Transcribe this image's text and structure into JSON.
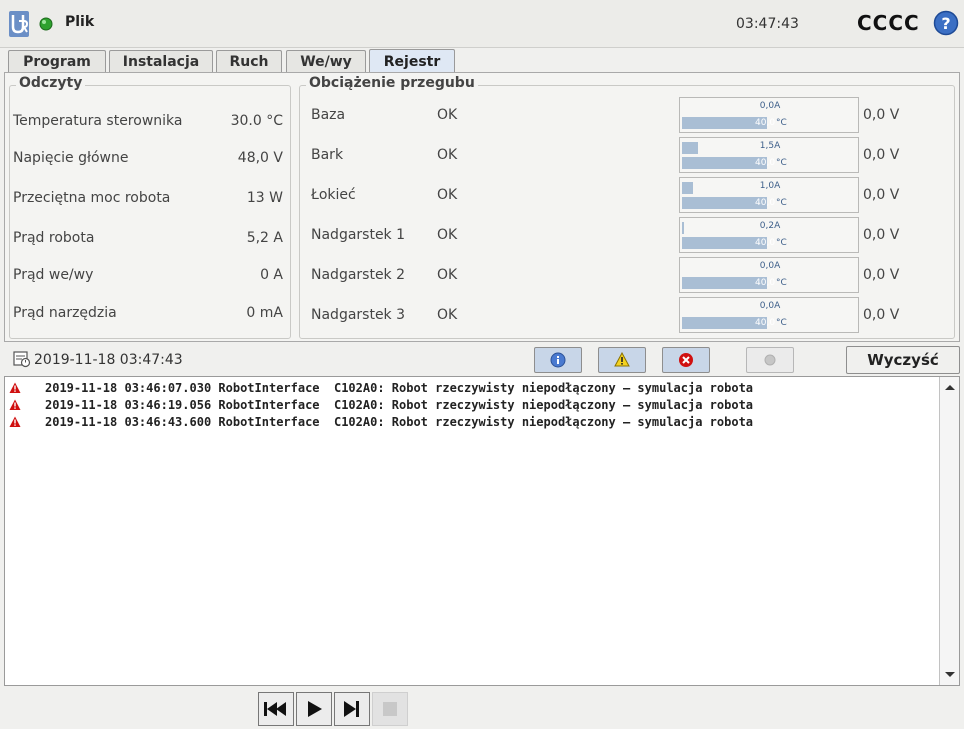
{
  "header": {
    "file_label": "Plik",
    "clock": "03:47:43",
    "robot_name": "CCCC"
  },
  "tabs": [
    {
      "label": "Program"
    },
    {
      "label": "Instalacja"
    },
    {
      "label": "Ruch"
    },
    {
      "label": "We/wy"
    },
    {
      "label": "Rejestr",
      "active": true
    }
  ],
  "readings": {
    "title": "Odczyty",
    "rows": [
      {
        "label": "Temperatura sterownika",
        "value": "30.0 °C"
      },
      {
        "label": "Napięcie główne",
        "value": "48,0  V"
      },
      {
        "label": "Przeciętna moc robota",
        "value": "13  W"
      },
      {
        "label": "Prąd robota",
        "value": "5,2  A"
      },
      {
        "label": "Prąd we/wy",
        "value": "0  A"
      },
      {
        "label": "Prąd narzędzia",
        "value": "0 mA"
      }
    ]
  },
  "joints": {
    "title": "Obciążenie przegubu",
    "rows": [
      {
        "name": "Baza",
        "status": "OK",
        "current": "0,0A",
        "current_fraction": 0.0,
        "temp": "40,0",
        "temp_unit": "°C",
        "voltage": "0,0 V"
      },
      {
        "name": "Bark",
        "status": "OK",
        "current": "1,5A",
        "current_fraction": 0.09,
        "temp": "40,0",
        "temp_unit": "°C",
        "voltage": "0,0 V"
      },
      {
        "name": "Łokieć",
        "status": "OK",
        "current": "1,0A",
        "current_fraction": 0.06,
        "temp": "40,0",
        "temp_unit": "°C",
        "voltage": "0,0 V"
      },
      {
        "name": "Nadgarstek 1",
        "status": "OK",
        "current": "0,2A",
        "current_fraction": 0.01,
        "temp": "40,0",
        "temp_unit": "°C",
        "voltage": "0,0 V"
      },
      {
        "name": "Nadgarstek 2",
        "status": "OK",
        "current": "0,0A",
        "current_fraction": 0.0,
        "temp": "40,0",
        "temp_unit": "°C",
        "voltage": "0,0 V"
      },
      {
        "name": "Nadgarstek 3",
        "status": "OK",
        "current": "0,0A",
        "current_fraction": 0.0,
        "temp": "40,0",
        "temp_unit": "°C",
        "voltage": "0,0 V"
      }
    ]
  },
  "log": {
    "date": "2019-11-18 03:47:43",
    "clear_label": "Wyczyść",
    "filters": [
      {
        "name": "info",
        "icon": "info-icon",
        "active": true
      },
      {
        "name": "warning",
        "icon": "warning-icon",
        "active": true
      },
      {
        "name": "error",
        "icon": "error-icon",
        "active": true
      },
      {
        "name": "debug",
        "icon": "dot-icon",
        "active": false
      }
    ],
    "entries": [
      {
        "level": "error",
        "text": "2019-11-18 03:46:07.030 RobotInterface  C102A0: Robot rzeczywisty niepodłączony – symulacja robota"
      },
      {
        "level": "error",
        "text": "2019-11-18 03:46:19.056 RobotInterface  C102A0: Robot rzeczywisty niepodłączony – symulacja robota"
      },
      {
        "level": "error",
        "text": "2019-11-18 03:46:43.600 RobotInterface  C102A0: Robot rzeczywisty niepodłączony – symulacja robota"
      }
    ]
  },
  "colors": {
    "bar_fill": "#a9bed4",
    "bar_text": "#3d5f8a",
    "error_red": "#d01010",
    "tab_active": "#dfe8f4",
    "status_green": "#2ea12e"
  },
  "playback": {
    "buttons": [
      "skip-start-icon",
      "play-icon",
      "step-forward-icon",
      "stop-icon"
    ]
  }
}
